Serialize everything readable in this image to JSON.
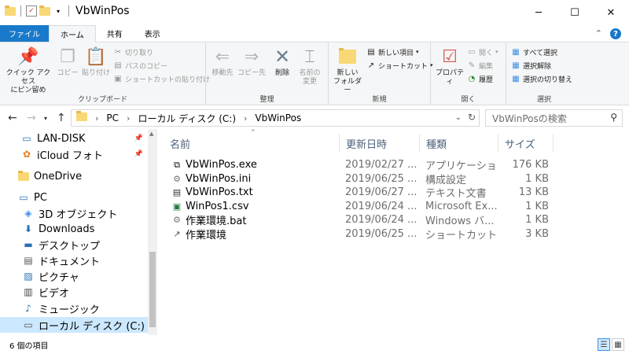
{
  "window": {
    "title": "VbWinPos",
    "minimize": "─",
    "maximize": "☐",
    "close": "✕"
  },
  "ribbon_tabs": [
    "ファイル",
    "ホーム",
    "共有",
    "表示"
  ],
  "ribbon": {
    "clipboard": {
      "label": "クリップボード",
      "pin_quick_access": "クイック アクセス\nにピン留め",
      "copy": "コピー",
      "paste": "貼り付け",
      "cut": "切り取り",
      "copy_path": "パスのコピー",
      "paste_shortcut": "ショートカットの貼り付け"
    },
    "organize": {
      "label": "整理",
      "move_to": "移動先",
      "copy_to": "コピー先",
      "delete": "削除",
      "rename": "名前の\n変更"
    },
    "new": {
      "label": "新規",
      "new_folder": "新しい\nフォルダー",
      "new_item": "新しい項目",
      "shortcut": "ショートカット"
    },
    "open": {
      "label": "開く",
      "properties": "プロパティ",
      "open": "開く",
      "edit": "編集",
      "history": "履歴"
    },
    "select": {
      "label": "選択",
      "select_all": "すべて選択",
      "select_none": "選択解除",
      "invert": "選択の切り替え"
    }
  },
  "address": {
    "path": [
      "PC",
      "ローカル ディスク (C:)",
      "VbWinPos"
    ],
    "search_placeholder": "VbWinPosの検索"
  },
  "nav": [
    {
      "label": "LAN-DISK",
      "icon": "monitor-icon",
      "pinned": true
    },
    {
      "label": "iCloud フォト",
      "icon": "icloud-photos-icon",
      "pinned": true
    },
    {
      "label": "OneDrive",
      "icon": "folder-icon",
      "pinned": false
    },
    {
      "label": "PC",
      "icon": "pc-icon",
      "pinned": false
    },
    {
      "label": "3D オブジェクト",
      "icon": "cube-icon",
      "pinned": false
    },
    {
      "label": "Downloads",
      "icon": "download-icon",
      "pinned": false
    },
    {
      "label": "デスクトップ",
      "icon": "desktop-icon",
      "pinned": false
    },
    {
      "label": "ドキュメント",
      "icon": "document-icon",
      "pinned": false
    },
    {
      "label": "ピクチャ",
      "icon": "picture-icon",
      "pinned": false
    },
    {
      "label": "ビデオ",
      "icon": "video-icon",
      "pinned": false
    },
    {
      "label": "ミュージック",
      "icon": "music-icon",
      "pinned": false
    },
    {
      "label": "ローカル ディスク (C:)",
      "icon": "drive-icon",
      "pinned": false
    }
  ],
  "columns": {
    "name": "名前",
    "date": "更新日時",
    "type": "種類",
    "size": "サイズ"
  },
  "files": [
    {
      "name": "VbWinPos.exe",
      "date": "2019/02/27 ...",
      "type": "アプリケーション",
      "size": "176 KB",
      "icon": "exe-icon"
    },
    {
      "name": "VbWinPos.ini",
      "date": "2019/06/25 ...",
      "type": "構成設定",
      "size": "1 KB",
      "icon": "ini-icon"
    },
    {
      "name": "VbWinPos.txt",
      "date": "2019/06/27 ...",
      "type": "テキスト文書",
      "size": "13 KB",
      "icon": "txt-icon"
    },
    {
      "name": "WinPos1.csv",
      "date": "2019/06/24 ...",
      "type": "Microsoft Ex...",
      "size": "1 KB",
      "icon": "excel-icon"
    },
    {
      "name": "作業環境.bat",
      "date": "2019/06/24 ...",
      "type": "Windows バ...",
      "size": "1 KB",
      "icon": "bat-icon"
    },
    {
      "name": "作業環境",
      "date": "2019/06/25 ...",
      "type": "ショートカット",
      "size": "3 KB",
      "icon": "shortcut-icon"
    }
  ],
  "status": {
    "count": "6 個の項目"
  },
  "colors": {
    "file_tab": "#1979ca",
    "selected": "#cce8ff",
    "header_text": "#4c607a"
  }
}
